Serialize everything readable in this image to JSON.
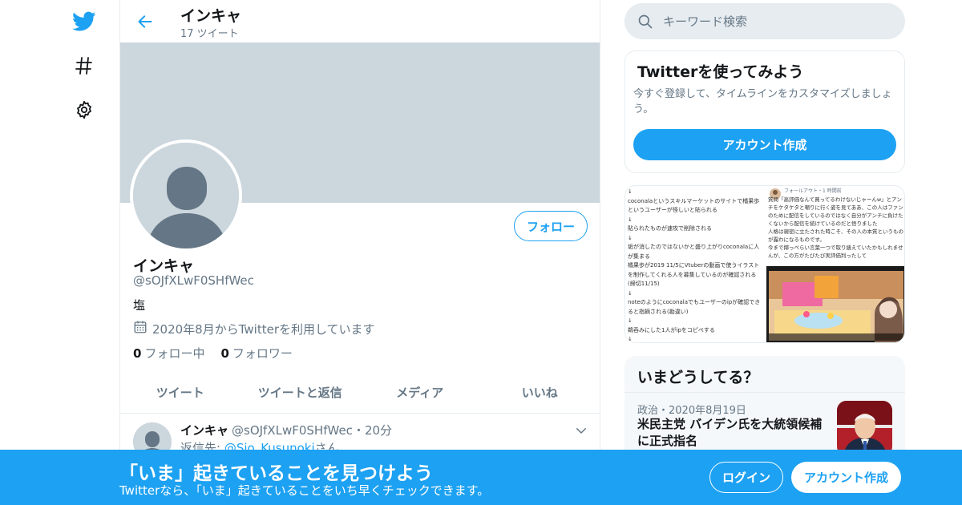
{
  "nav": {
    "icons": [
      "twitter-bird-icon",
      "hashtag-icon",
      "gear-icon"
    ]
  },
  "header": {
    "title": "インキャ",
    "tweet_count": "17 ツイート"
  },
  "profile": {
    "follow_label": "フォロー",
    "name": "インキャ",
    "handle": "@sOJfXLwF0SHfWec",
    "bio": "塩",
    "joined": "2020年8月からTwitterを利用しています",
    "following_count": "0",
    "following_label": "フォロー中",
    "followers_count": "0",
    "followers_label": "フォロワー"
  },
  "tabs": [
    {
      "label": "ツイート"
    },
    {
      "label": "ツイートと返信"
    },
    {
      "label": "メディア"
    },
    {
      "label": "いいね"
    }
  ],
  "tweet": {
    "name": "インキャ",
    "handle": "@sOJfXLwF0SHfWec",
    "time": "・20分",
    "reply_prefix": "返信先: ",
    "reply_to": "@Sio_Kusunoki",
    "reply_suffix": "さん"
  },
  "search": {
    "placeholder": "キーワード検索"
  },
  "signup_card": {
    "title": "Twitterを使ってみよう",
    "description": "今すぐ登録して、タイムラインをカスタマイズしましょう。",
    "button": "アカウント作成"
  },
  "media_card": {
    "left_text": "↓\ncoconalaというスキルマーケットのサイトで橘果歩というユーザーが怪しいと貼られる\n↓\n貼られたものが速攻で削除される\n↓\n垢が消したのではないかと盛り上がりcoconalaに人が集まる\n橘果歩が2019 11/5にVtuberの動画で使うイラストを制作してくれる人を募集しているのが確認される(締切11/15)\n↓\nnoteのようにcoconalaでもユーザーのipが確認できると指摘される(勘違い)\n↓\n鵜呑みにした1人がipをコピペする\n↓",
    "right_header": "フォールアウト・1 時間前",
    "right_text": "質問「高評価なんて買ってるわけないじゃーんw」とアンチをケタケタと嘲りに行く姿を見てああ、この人はファンのために配信をしているのではなく自分がアンチに負けたくないから配信を続けているのだと悟りました\n人格は親密に立たされた時こそ、その人の本質というものが露わになるものです。\n今まで揶っぺらい言葉一つで取り繕えていたかもしれませんが、この方がたびたび実評価判ったして"
  },
  "trends": {
    "title": "いまどうしてる？",
    "item": {
      "meta": "政治・2020年8月19日",
      "text": "米民主党 バイデン氏を大統領候補に正式指名"
    }
  },
  "bottom_bar": {
    "title": "「いま」起きていることを見つけよう",
    "subtitle": "Twitterなら、「いま」起きていることをいち早くチェックできます。",
    "login": "ログイン",
    "signup": "アカウント作成"
  },
  "colors": {
    "accent": "#1da1f2",
    "banner": "#ccd6dd",
    "muted_text": "#657786",
    "border": "#e6ecf0"
  }
}
